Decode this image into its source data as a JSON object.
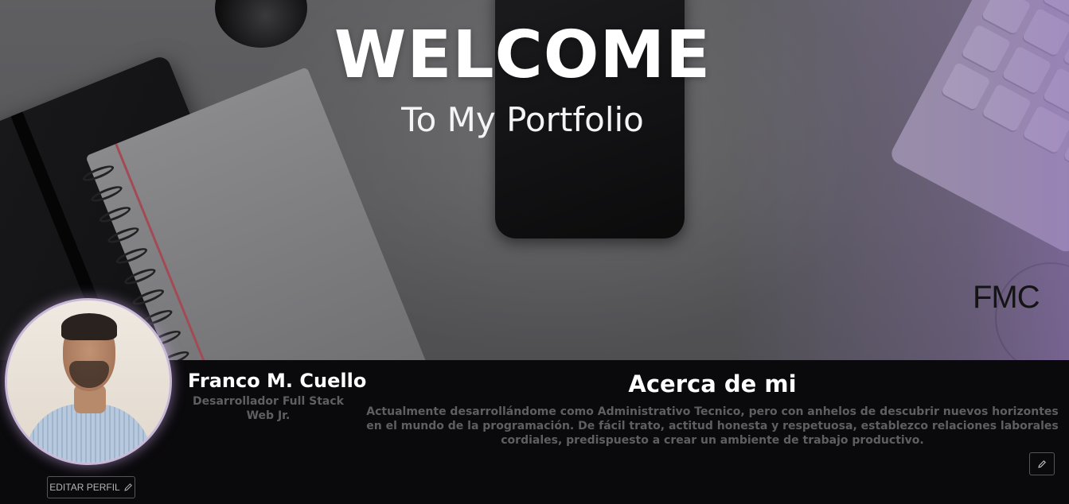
{
  "hero": {
    "title": "WELCOME",
    "subtitle": "To My Portfolio",
    "brand": "FMC"
  },
  "profile": {
    "name": "Franco M. Cuello",
    "role": "Desarrollador Full Stack Web Jr.",
    "edit_label": "EDITAR PERFIL",
    "edit_icon": "pencil-icon"
  },
  "about": {
    "title": "Acerca de mi",
    "text": "Actualmente desarrollándome como Administrativo Tecnico, pero con anhelos de descubrir nuevos horizontes en el mundo de la programación. De fácil trato, actitud honesta y respetuosa, establezco relaciones laborales cordiales, predispuesto a crear un ambiente de trabajo productivo.",
    "edit_icon": "pencil-icon"
  },
  "colors": {
    "background": "#0a090c",
    "muted_text": "#5e5e63",
    "avatar_glow": "#c9b9d9"
  }
}
